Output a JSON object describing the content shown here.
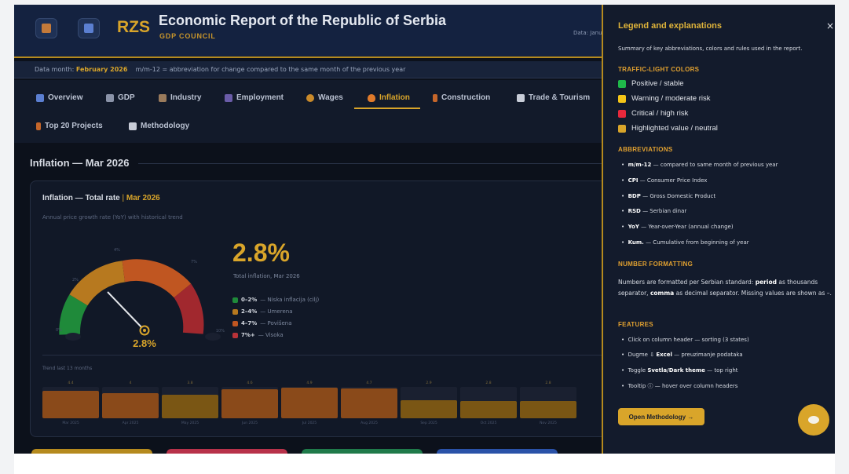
{
  "header": {
    "brand": "RZS",
    "title": "Economic Report of the Republic of Serbia",
    "subtitle": "GDP COUNCIL",
    "data_label": "Data: Janu"
  },
  "infobar": {
    "label": "Data month:",
    "month": "February 2026",
    "note": "m/m-12 = abbreviation for change compared to the same month of the previous year"
  },
  "tabs": [
    {
      "label": "Overview",
      "icon": "chart-icon"
    },
    {
      "label": "GDP",
      "icon": "bar-chart-icon"
    },
    {
      "label": "Industry",
      "icon": "factory-icon"
    },
    {
      "label": "Employment",
      "icon": "people-icon"
    },
    {
      "label": "Wages",
      "icon": "money-bag-icon"
    },
    {
      "label": "Inflation",
      "icon": "fire-icon",
      "active": true
    },
    {
      "label": "Construction",
      "icon": "crane-icon"
    },
    {
      "label": "Trade & Tourism",
      "icon": "plane-icon"
    },
    {
      "label": "Top 20 Projects",
      "icon": "crane-icon"
    },
    {
      "label": "Methodology",
      "icon": "book-icon"
    }
  ],
  "section": {
    "title": "Inflation — Mar 2026"
  },
  "card": {
    "title": "Inflation — Total rate",
    "separator": "|",
    "month": "Mar 2026",
    "subtitle": "Annual price growth rate (YoY) with historical trend",
    "gauge": {
      "value_text": "2.8%",
      "value": 2.8,
      "max": 10,
      "ticks": [
        "0%",
        "2%",
        "4%",
        "7%",
        "10%"
      ]
    },
    "big_value": "2.8%",
    "big_caption": "Total inflation, Mar 2026",
    "legend": [
      {
        "range": "0–2%",
        "desc": "— Niska inflacija (cilj)",
        "color": "#1f8a3a"
      },
      {
        "range": "2–4%",
        "desc": "— Umerena",
        "color": "#b7791f"
      },
      {
        "range": "4–7%",
        "desc": "— Povišena",
        "color": "#c05621"
      },
      {
        "range": "7%+",
        "desc": "— Visoka",
        "color": "#b83238"
      }
    ],
    "trend_label": "Trend last 13 months"
  },
  "chart_data": {
    "type": "bar",
    "title": "Trend last 13 months",
    "categories": [
      "Mar 2025",
      "Apr 2025",
      "May 2025",
      "Jun 2025",
      "Jul 2025",
      "Aug 2025",
      "Sep 2025",
      "Oct 2025",
      "Nov 2025"
    ],
    "values": [
      4.4,
      4,
      3.8,
      4.6,
      4.9,
      4.7,
      2.9,
      2.8,
      2.8
    ],
    "value_labels": [
      "4.4",
      "4",
      "3.8",
      "4.6",
      "4.9",
      "4.7",
      "2.9",
      "2.8",
      "2.8"
    ],
    "ylim": [
      0,
      5
    ],
    "colors": {
      "high": "#8a4a1a",
      "moderate": "#7a5614"
    }
  },
  "panel": {
    "title": "Legend and explanations",
    "close": "×",
    "intro": "Summary of key abbreviations, colors and rules used in the report.",
    "colors_heading": "TRAFFIC-LIGHT COLORS",
    "colors": [
      {
        "label": "Positive / stable",
        "color": "#1fb84a"
      },
      {
        "label": "Warning / moderate risk",
        "color": "#f5c518"
      },
      {
        "label": "Critical / high risk",
        "color": "#e8283c"
      },
      {
        "label": "Highlighted value / neutral",
        "color": "#d9a52a"
      }
    ],
    "abbr_heading": "ABBREVIATIONS",
    "abbreviations": [
      {
        "term": "m/m-12",
        "desc": "— compared to same month of previous year"
      },
      {
        "term": "CPI",
        "desc": "— Consumer Price Index"
      },
      {
        "term": "BDP",
        "desc": "— Gross Domestic Product"
      },
      {
        "term": "RSD",
        "desc": "— Serbian dinar"
      },
      {
        "term": "YoY",
        "desc": "— Year-over-Year (annual change)"
      },
      {
        "term": "Kum.",
        "desc": "— Cumulative from beginning of year"
      }
    ],
    "num_heading": "NUMBER FORMATTING",
    "num_text_1": "Numbers are formatted per Serbian standard: ",
    "num_bold_1": "period",
    "num_text_2": " as thousands separator, ",
    "num_bold_2": "comma",
    "num_text_3": " as decimal separator. Missing values are shown as –.",
    "feat_heading": "FEATURES",
    "features": [
      {
        "pre": "Click on column header — sorting (3 states)",
        "bold": "",
        "post": ""
      },
      {
        "pre": "Dugme ⇩ ",
        "bold": "Excel",
        "post": " — preuzimanje podataka"
      },
      {
        "pre": "Toggle ",
        "bold": "Svetla/Dark theme",
        "post": " — top right"
      },
      {
        "pre": "Tooltip ⓘ — hover over column headers",
        "bold": "",
        "post": ""
      }
    ],
    "button": "Open Methodology →"
  }
}
